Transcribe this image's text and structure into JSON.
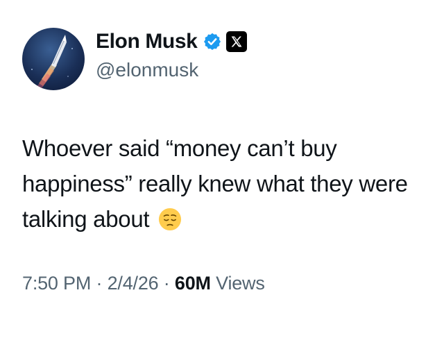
{
  "author": {
    "display_name": "Elon Musk",
    "handle": "@elonmusk",
    "verified_icon": "verified-checkmark-icon",
    "affiliation_icon": "x-logo-icon",
    "badge_color": "#1d9bf0"
  },
  "tweet": {
    "text": "Whoever said “money can’t buy happiness” really knew what they were talking about",
    "emoji": "pensive-face-emoji"
  },
  "meta": {
    "time": "7:50 PM",
    "separator": "·",
    "date": "2/4/26",
    "views_count": "60M",
    "views_label": "Views"
  },
  "colors": {
    "text_primary": "#0f1419",
    "text_secondary": "#536471",
    "background": "#ffffff"
  }
}
